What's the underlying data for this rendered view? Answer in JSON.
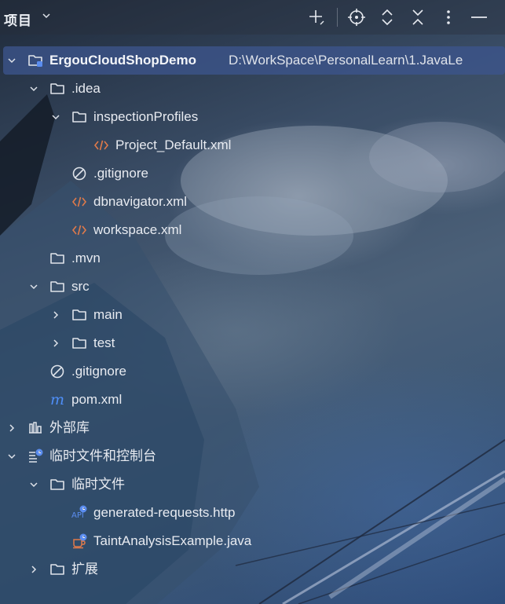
{
  "header": {
    "title": "项目",
    "actions": [
      "add-icon",
      "locate-icon",
      "expand-all-icon",
      "collapse-all-icon",
      "more-icon",
      "minimize-icon"
    ]
  },
  "colors": {
    "selection": "#3c558c",
    "folder_stroke": "#dfe3ea",
    "xml_icon": "#e07a4a",
    "maven_icon": "#4f8ef7",
    "badge": "#5b8def"
  },
  "tree": [
    {
      "depth": 0,
      "expanded": true,
      "icon": "module-folder-icon",
      "label": "ErgouCloudShopDemo",
      "path": "D:\\WorkSpace\\PersonalLearn\\1.JavaLe",
      "selected": true
    },
    {
      "depth": 1,
      "expanded": true,
      "icon": "folder-icon",
      "label": ".idea"
    },
    {
      "depth": 2,
      "expanded": true,
      "icon": "folder-icon",
      "label": "inspectionProfiles"
    },
    {
      "depth": 3,
      "expanded": null,
      "icon": "xml-file-icon",
      "label": "Project_Default.xml"
    },
    {
      "depth": 2,
      "expanded": null,
      "icon": "ignore-file-icon",
      "label": ".gitignore"
    },
    {
      "depth": 2,
      "expanded": null,
      "icon": "xml-file-icon",
      "label": "dbnavigator.xml"
    },
    {
      "depth": 2,
      "expanded": null,
      "icon": "xml-file-icon",
      "label": "workspace.xml"
    },
    {
      "depth": 1,
      "expanded": null,
      "icon": "folder-icon",
      "label": ".mvn"
    },
    {
      "depth": 1,
      "expanded": true,
      "icon": "folder-icon",
      "label": "src"
    },
    {
      "depth": 2,
      "expanded": false,
      "icon": "folder-icon",
      "label": "main"
    },
    {
      "depth": 2,
      "expanded": false,
      "icon": "folder-icon",
      "label": "test"
    },
    {
      "depth": 1,
      "expanded": null,
      "icon": "ignore-file-icon",
      "label": ".gitignore"
    },
    {
      "depth": 1,
      "expanded": null,
      "icon": "maven-file-icon",
      "label": "pom.xml"
    },
    {
      "depth": 0,
      "expanded": false,
      "icon": "library-icon",
      "label": "外部库"
    },
    {
      "depth": 0,
      "expanded": true,
      "icon": "scratches-icon",
      "label": "临时文件和控制台"
    },
    {
      "depth": 1,
      "expanded": true,
      "icon": "folder-icon",
      "label": "临时文件"
    },
    {
      "depth": 2,
      "expanded": null,
      "icon": "http-file-icon",
      "label": "generated-requests.http"
    },
    {
      "depth": 2,
      "expanded": null,
      "icon": "java-scratch-icon",
      "label": "TaintAnalysisExample.java"
    },
    {
      "depth": 1,
      "expanded": false,
      "icon": "folder-icon",
      "label": "扩展"
    }
  ]
}
